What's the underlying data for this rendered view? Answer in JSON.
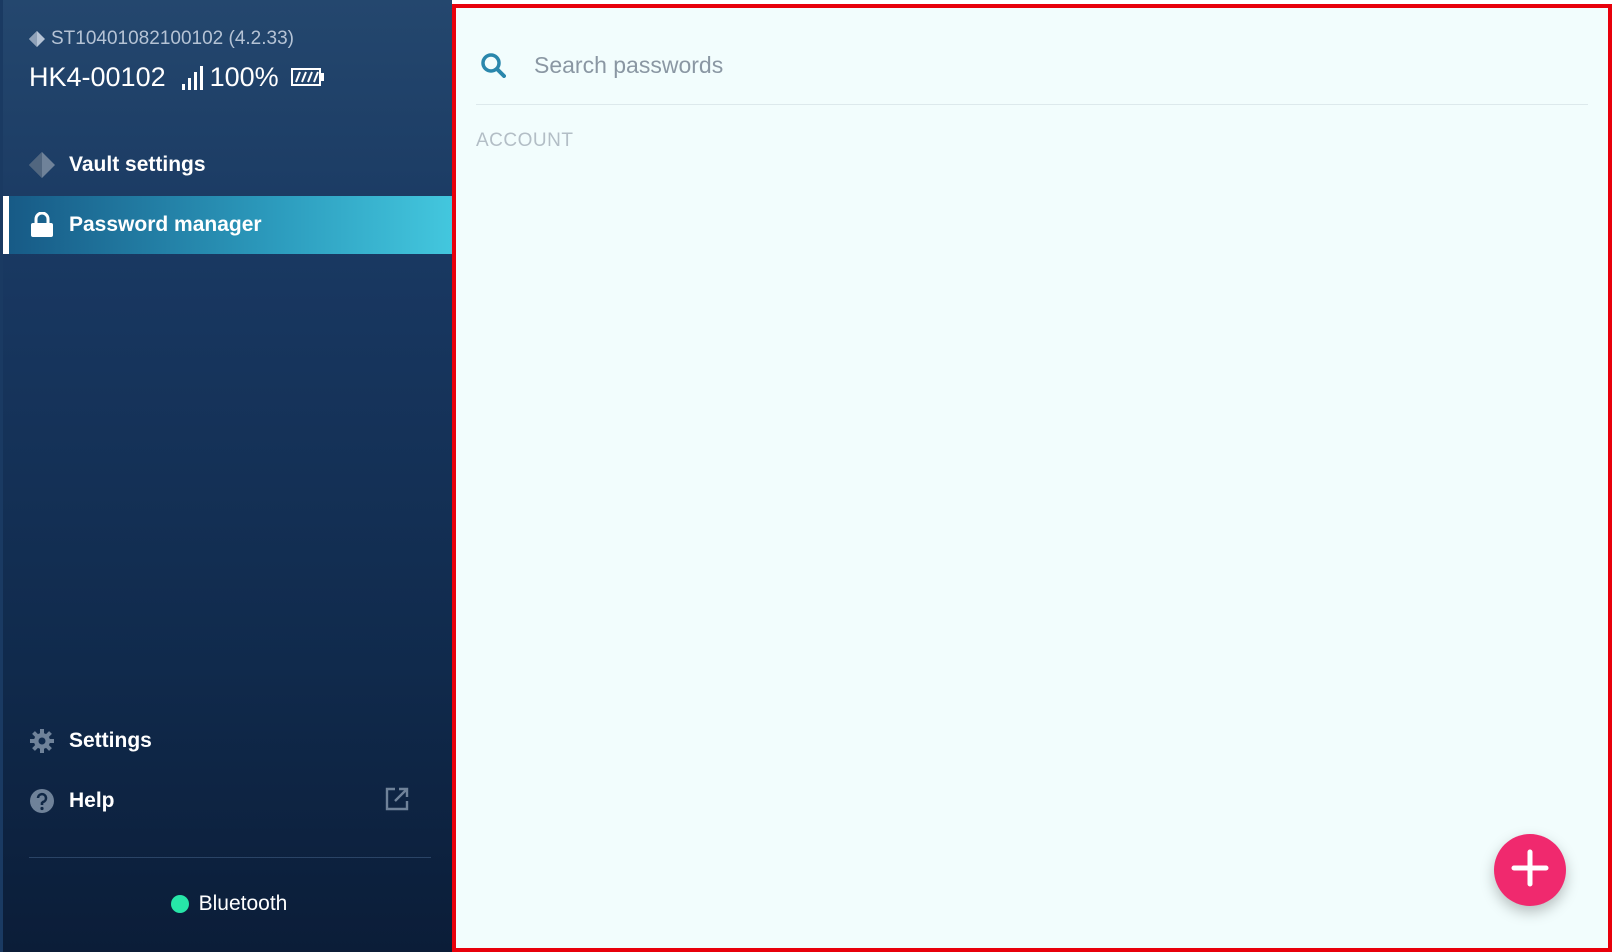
{
  "device": {
    "serial_version": "ST10401082100102 (4.2.33)",
    "name": "HK4-00102",
    "battery": "100%"
  },
  "nav": {
    "vault_settings": "Vault settings",
    "password_manager": "Password manager",
    "settings": "Settings",
    "help": "Help"
  },
  "connection": {
    "label": "Bluetooth",
    "status_color": "#27e6a8"
  },
  "search": {
    "placeholder": "Search passwords"
  },
  "list": {
    "section_label": "ACCOUNT"
  },
  "colors": {
    "accent": "#43c7de",
    "fab": "#f0296e",
    "highlight_border": "#e8000b"
  },
  "icons": {
    "device": "diamond-icon",
    "signal": "signal-icon",
    "battery": "battery-icon",
    "vault": "diamond-icon",
    "password": "lock-icon",
    "settings": "gear-icon",
    "help": "help-icon",
    "external": "external-link-icon",
    "search": "search-icon",
    "add": "plus-icon"
  }
}
